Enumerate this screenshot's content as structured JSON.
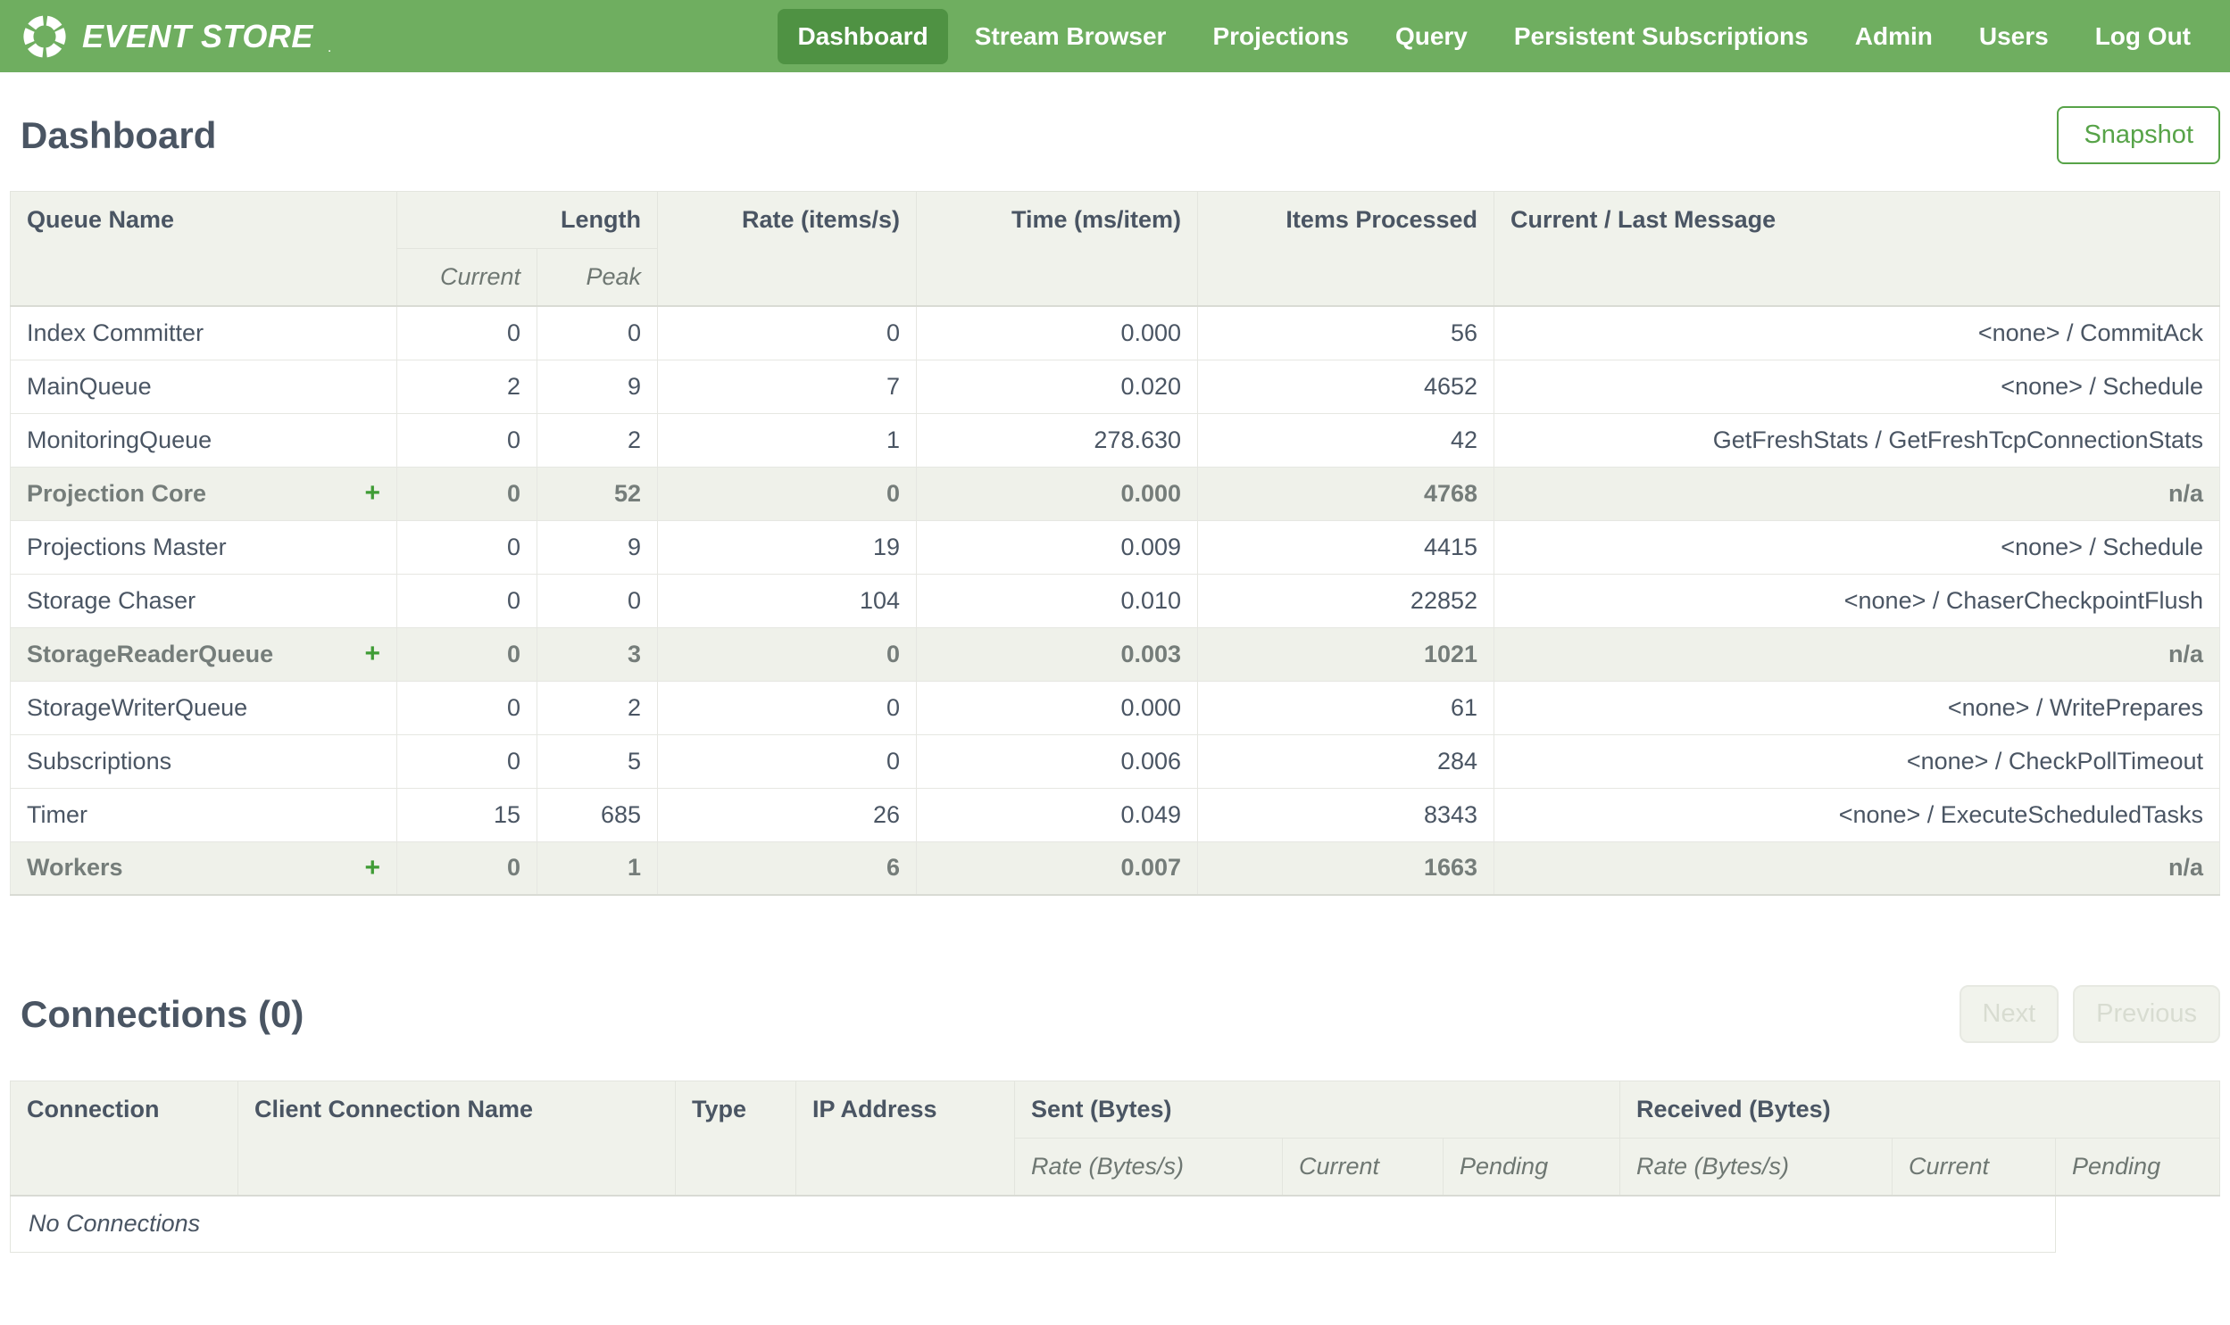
{
  "nav": {
    "brand": "EVENT STORE",
    "brand_dot": ".",
    "items": [
      {
        "label": "Dashboard",
        "active": true
      },
      {
        "label": "Stream Browser",
        "active": false
      },
      {
        "label": "Projections",
        "active": false
      },
      {
        "label": "Query",
        "active": false
      },
      {
        "label": "Persistent Subscriptions",
        "active": false
      },
      {
        "label": "Admin",
        "active": false
      },
      {
        "label": "Users",
        "active": false
      },
      {
        "label": "Log Out",
        "active": false
      }
    ]
  },
  "dashboard": {
    "title": "Dashboard",
    "snapshot_label": "Snapshot"
  },
  "queue_table": {
    "columns": {
      "queue_name": "Queue Name",
      "length": "Length",
      "current": "Current",
      "peak": "Peak",
      "rate": "Rate (items/s)",
      "time": "Time (ms/item)",
      "items_processed": "Items Processed",
      "message": "Current / Last Message"
    },
    "expand_icon": "+",
    "rows": [
      {
        "name": "Index Committer",
        "current": "0",
        "peak": "0",
        "rate": "0",
        "time": "0.000",
        "items": "56",
        "message": "<none> / CommitAck",
        "group": false
      },
      {
        "name": "MainQueue",
        "current": "2",
        "peak": "9",
        "rate": "7",
        "time": "0.020",
        "items": "4652",
        "message": "<none> / Schedule",
        "group": false
      },
      {
        "name": "MonitoringQueue",
        "current": "0",
        "peak": "2",
        "rate": "1",
        "time": "278.630",
        "items": "42",
        "message": "GetFreshStats / GetFreshTcpConnectionStats",
        "group": false
      },
      {
        "name": "Projection Core",
        "current": "0",
        "peak": "52",
        "rate": "0",
        "time": "0.000",
        "items": "4768",
        "message": "n/a",
        "group": true
      },
      {
        "name": "Projections Master",
        "current": "0",
        "peak": "9",
        "rate": "19",
        "time": "0.009",
        "items": "4415",
        "message": "<none> / Schedule",
        "group": false
      },
      {
        "name": "Storage Chaser",
        "current": "0",
        "peak": "0",
        "rate": "104",
        "time": "0.010",
        "items": "22852",
        "message": "<none> / ChaserCheckpointFlush",
        "group": false
      },
      {
        "name": "StorageReaderQueue",
        "current": "0",
        "peak": "3",
        "rate": "0",
        "time": "0.003",
        "items": "1021",
        "message": "n/a",
        "group": true
      },
      {
        "name": "StorageWriterQueue",
        "current": "0",
        "peak": "2",
        "rate": "0",
        "time": "0.000",
        "items": "61",
        "message": "<none> / WritePrepares",
        "group": false
      },
      {
        "name": "Subscriptions",
        "current": "0",
        "peak": "5",
        "rate": "0",
        "time": "0.006",
        "items": "284",
        "message": "<none> / CheckPollTimeout",
        "group": false
      },
      {
        "name": "Timer",
        "current": "15",
        "peak": "685",
        "rate": "26",
        "time": "0.049",
        "items": "8343",
        "message": "<none> / ExecuteScheduledTasks",
        "group": false
      },
      {
        "name": "Workers",
        "current": "0",
        "peak": "1",
        "rate": "6",
        "time": "0.007",
        "items": "1663",
        "message": "n/a",
        "group": true
      }
    ]
  },
  "connections": {
    "title": "Connections (0)",
    "next_label": "Next",
    "previous_label": "Previous",
    "columns": {
      "connection": "Connection",
      "client_name": "Client Connection Name",
      "type": "Type",
      "ip": "IP Address",
      "sent": "Sent (Bytes)",
      "received": "Received (Bytes)",
      "rate": "Rate (Bytes/s)",
      "current": "Current",
      "pending": "Pending"
    },
    "empty_text": "No Connections"
  },
  "colors": {
    "nav_green": "#6fae60",
    "nav_active_green": "#4f9243",
    "accent_green": "#57a348",
    "plus_green": "#3f9c35",
    "header_bg": "#f0f2eb",
    "text_dark": "#4a5563",
    "group_text": "#757d7a"
  }
}
